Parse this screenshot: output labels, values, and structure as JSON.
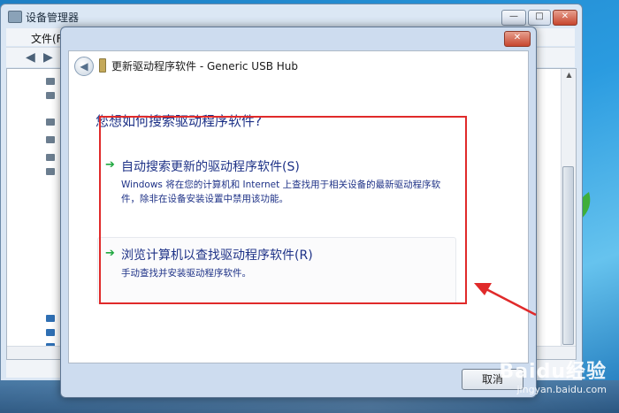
{
  "device_manager": {
    "title": "设备管理器",
    "menu_file": "文件(F)",
    "controls": {
      "minimize": "—",
      "maximize": "□",
      "close": "✕"
    }
  },
  "dialog": {
    "title": "更新驱动程序软件 - Generic USB Hub",
    "question": "您想如何搜索驱动程序软件?",
    "options": [
      {
        "title": "自动搜索更新的驱动程序软件(S)",
        "description": "Windows 将在您的计算机和 Internet 上查找用于相关设备的最新驱动程序软件，除非在设备安装设置中禁用该功能。"
      },
      {
        "title": "浏览计算机以查找驱动程序软件(R)",
        "description": "手动查找并安装驱动程序软件。"
      }
    ],
    "cancel_label": "取消"
  },
  "icons": {
    "back": "back-arrow-icon",
    "usb": "usb-device-icon",
    "option_arrow": "green-arrow-icon"
  },
  "colors": {
    "highlight": "#e02a2a",
    "link_text": "#1e3287",
    "arrow": "#20a840"
  },
  "watermark": {
    "main": "Baidu经验",
    "sub": "jingyan.baidu.com"
  }
}
